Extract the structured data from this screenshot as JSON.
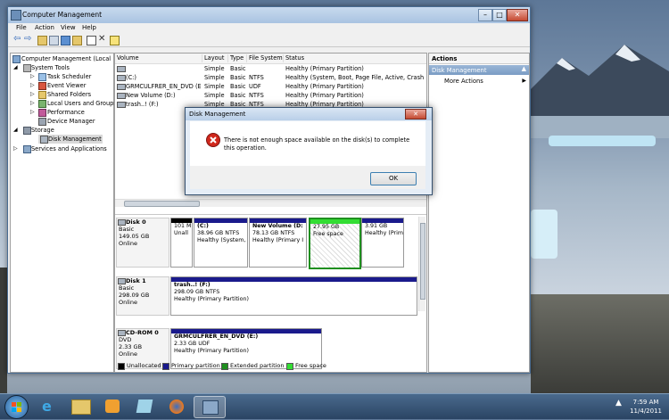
{
  "window": {
    "title": "Computer Management"
  },
  "menu": [
    "File",
    "Action",
    "View",
    "Help"
  ],
  "tree": [
    {
      "label": "Computer Management (Local",
      "icon": "computer-icon"
    },
    {
      "label": "System Tools",
      "icon": "tools-icon"
    },
    {
      "label": "Task Scheduler",
      "icon": "clock-icon"
    },
    {
      "label": "Event Viewer",
      "icon": "event-icon"
    },
    {
      "label": "Shared Folders",
      "icon": "folder-icon"
    },
    {
      "label": "Local Users and Groups",
      "icon": "users-icon"
    },
    {
      "label": "Performance",
      "icon": "performance-icon"
    },
    {
      "label": "Device Manager",
      "icon": "device-icon"
    },
    {
      "label": "Storage",
      "icon": "storage-icon"
    },
    {
      "label": "Disk Management",
      "icon": "disk-icon"
    },
    {
      "label": "Services and Applications",
      "icon": "services-icon"
    }
  ],
  "volume_table": {
    "headers": [
      "Volume",
      "Layout",
      "Type",
      "File System",
      "Status"
    ],
    "rows": [
      [
        "",
        "Simple",
        "Basic",
        "",
        "Healthy (Primary Partition)"
      ],
      [
        "(C:)",
        "Simple",
        "Basic",
        "NTFS",
        "Healthy (System, Boot, Page File, Active, Crash Du"
      ],
      [
        "GRMCULFRER_EN_DVD (E:)",
        "Simple",
        "Basic",
        "UDF",
        "Healthy (Primary Partition)"
      ],
      [
        "New Volume (D:)",
        "Simple",
        "Basic",
        "NTFS",
        "Healthy (Primary Partition)"
      ],
      [
        "trash..! (F:)",
        "Simple",
        "Basic",
        "NTFS",
        "Healthy (Primary Partition)"
      ]
    ]
  },
  "disks": [
    {
      "name": "Disk 0",
      "info": [
        "Basic",
        "149.05 GB",
        "Online"
      ],
      "parts": [
        {
          "t1": "",
          "t2": "101 M",
          "t3": "Unall"
        },
        {
          "t1": "(C:)",
          "t2": "38.96 GB NTFS",
          "t3": "Healthy (System,"
        },
        {
          "t1": "New Volume (D:",
          "t2": "78.13 GB NTFS",
          "t3": "Healthy (Primary I"
        },
        {
          "t1": "",
          "t2": "27.95 GB",
          "t3": "Free space"
        },
        {
          "t1": "",
          "t2": "3.91 GB",
          "t3": "Healthy (Prim"
        }
      ]
    },
    {
      "name": "Disk 1",
      "info": [
        "Basic",
        "298.09 GB",
        "Online"
      ],
      "parts": [
        {
          "t1": "trash..! (F:)",
          "t2": "298.09 GB NTFS",
          "t3": "Healthy (Primary Partition)"
        }
      ]
    },
    {
      "name": "CD-ROM 0",
      "info": [
        "DVD",
        "2.33 GB",
        "Online"
      ],
      "parts": [
        {
          "t1": "GRMCULFRER_EN_DVD (E:)",
          "t2": "2.33 GB UDF",
          "t3": "Healthy (Primary Partition)"
        }
      ]
    }
  ],
  "legend": [
    {
      "label": "Unallocated",
      "color": "#000000"
    },
    {
      "label": "Primary partition",
      "color": "#1a1a8c"
    },
    {
      "label": "Extended partition",
      "color": "#1f8f1f"
    },
    {
      "label": "Free space",
      "color": "#33dd33"
    }
  ],
  "actions": {
    "header": "Actions",
    "section": "Disk Management",
    "item": "More Actions"
  },
  "dialog": {
    "title": "Disk Management",
    "message": "There is not enough space available on the disk(s) to complete this operation.",
    "ok": "OK"
  },
  "taskbar": {
    "time": "7:59 AM",
    "date": "11/4/2011"
  }
}
